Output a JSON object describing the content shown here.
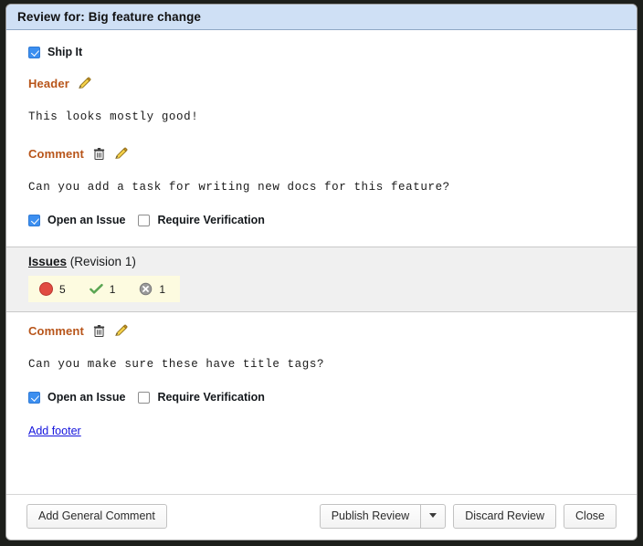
{
  "dialog": {
    "title": "Review for: Big feature change"
  },
  "review": {
    "ship_it": {
      "label": "Ship It",
      "checked": true
    },
    "header": {
      "label": "Header",
      "edit_icon": "pencil-icon",
      "text": "This looks mostly good!"
    },
    "general_comment": {
      "label": "Comment",
      "delete_icon": "trash-icon",
      "edit_icon": "pencil-icon",
      "text": "Can you add a task for writing new docs for this feature?",
      "open_issue": {
        "label": "Open an Issue",
        "checked": true
      },
      "require_verification": {
        "label": "Require Verification",
        "checked": false
      }
    }
  },
  "issues": {
    "heading_word": "Issues",
    "heading_revision": "(Revision 1)",
    "counts": [
      {
        "icon": "open-issue-dot-icon",
        "value": "5"
      },
      {
        "icon": "resolved-check-icon",
        "value": "1"
      },
      {
        "icon": "dropped-x-icon",
        "value": "1"
      }
    ],
    "comment": {
      "label": "Comment",
      "delete_icon": "trash-icon",
      "edit_icon": "pencil-icon",
      "text": "Can you make sure these have title tags?",
      "open_issue": {
        "label": "Open an Issue",
        "checked": true
      },
      "require_verification": {
        "label": "Require Verification",
        "checked": false
      }
    }
  },
  "footer_link": {
    "add_footer": "Add footer"
  },
  "footer": {
    "add_general_comment": "Add General Comment",
    "publish_review": "Publish Review",
    "publish_caret": "chevron-down-icon",
    "discard_review": "Discard Review",
    "close": "Close"
  },
  "colors": {
    "titlebar_bg": "#cfe0f5",
    "field_label": "#b8551a",
    "checkbox_on": "#3c8ff0",
    "issues_band_bg": "#f0f0f0",
    "issue_counts_bg": "#fdfbe0",
    "open_issue_dot": "#e14b42",
    "resolved_check": "#5aa552",
    "dropped_x": "#9a9a9a",
    "link": "#1414dd"
  }
}
